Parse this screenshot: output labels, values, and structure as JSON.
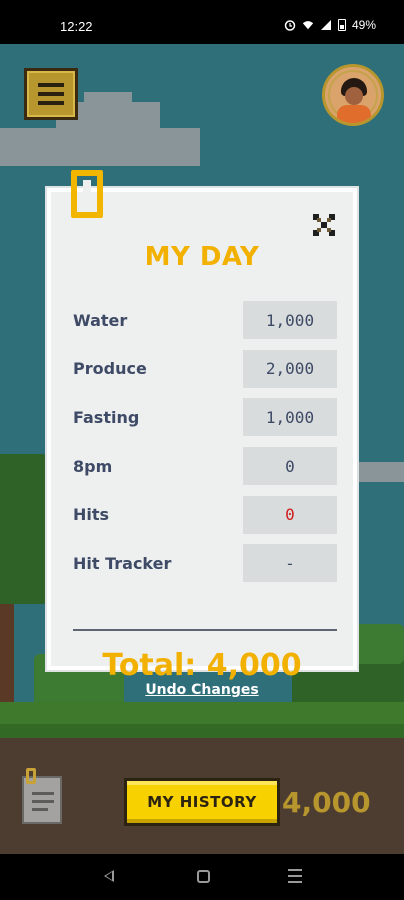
{
  "status_bar": {
    "time": "12:22",
    "battery": "49%",
    "icons": [
      "alarm-icon",
      "wifi-icon",
      "signal-icon",
      "battery-icon"
    ]
  },
  "header": {
    "menu_icon": "hamburger-menu-icon",
    "avatar_icon": "user-avatar"
  },
  "dialog": {
    "title": "MY DAY",
    "close_icon": "close-x-icon",
    "rows": [
      {
        "label": "Water",
        "value": "1,000"
      },
      {
        "label": "Produce",
        "value": "2,000"
      },
      {
        "label": "Fasting",
        "value": "1,000"
      },
      {
        "label": "8pm",
        "value": "0"
      },
      {
        "label": "Hits",
        "value": "0"
      },
      {
        "label": "Hit Tracker",
        "value": "-"
      }
    ],
    "total": "Total: 4,000"
  },
  "undo_label": "Undo Changes",
  "footer": {
    "history_label": "MY HISTORY",
    "score": "4,000"
  },
  "colors": {
    "accent": "#f2b100",
    "hit_value": "#d21b1b",
    "label_text": "#3e4a66",
    "sky": "#2f6f7a",
    "history_button": "#f7d100"
  }
}
